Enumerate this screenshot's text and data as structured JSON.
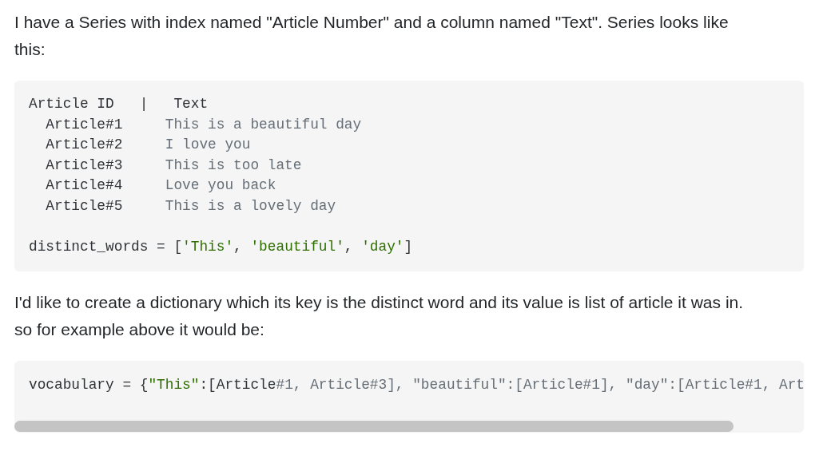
{
  "blocks": [
    {
      "kind": "paragraph",
      "text": "I have a Series with index named \"Article Number\" and a column named \"Text\". Series looks like this:"
    },
    {
      "kind": "code",
      "sections": [
        {
          "lines": [
            [
              {
                "text": "Article ID   |   Text",
                "kind": "plain"
              }
            ],
            [
              {
                "text": "  Article#1     ",
                "kind": "plain"
              },
              {
                "text": "This is a beautiful day",
                "kind": "comment"
              }
            ],
            [
              {
                "text": "  Article#2     ",
                "kind": "plain"
              },
              {
                "text": "I love you",
                "kind": "comment"
              }
            ],
            [
              {
                "text": "  Article#3     ",
                "kind": "plain"
              },
              {
                "text": "This is too late",
                "kind": "comment"
              }
            ],
            [
              {
                "text": "  Article#4     ",
                "kind": "plain"
              },
              {
                "text": "Love you back",
                "kind": "comment"
              }
            ],
            [
              {
                "text": "  Article#5     ",
                "kind": "plain"
              },
              {
                "text": "This is a lovely day",
                "kind": "comment"
              }
            ]
          ]
        },
        {
          "lines": [
            [
              {
                "text": "distinct_words = [",
                "kind": "plain"
              },
              {
                "text": "'This'",
                "kind": "string"
              },
              {
                "text": ", ",
                "kind": "plain"
              },
              {
                "text": "'beautiful'",
                "kind": "string"
              },
              {
                "text": ", ",
                "kind": "plain"
              },
              {
                "text": "'day'",
                "kind": "string"
              },
              {
                "text": "]",
                "kind": "plain"
              }
            ]
          ]
        }
      ]
    },
    {
      "kind": "paragraph",
      "text": "I'd like to create a dictionary which its key is the distinct word and its value is list of article it was in. so for example above it would be:"
    },
    {
      "kind": "code",
      "scrollbar": true,
      "sections": [
        {
          "lines": [
            [
              {
                "text": "vocabulary = {",
                "kind": "plain"
              },
              {
                "text": "\"This\"",
                "kind": "string"
              },
              {
                "text": ":[Article",
                "kind": "plain"
              },
              {
                "text": "#1, Article#3], \"beautiful\":[Article#1], \"day\":[Article#1, Art",
                "kind": "comment"
              }
            ]
          ]
        }
      ]
    }
  ]
}
